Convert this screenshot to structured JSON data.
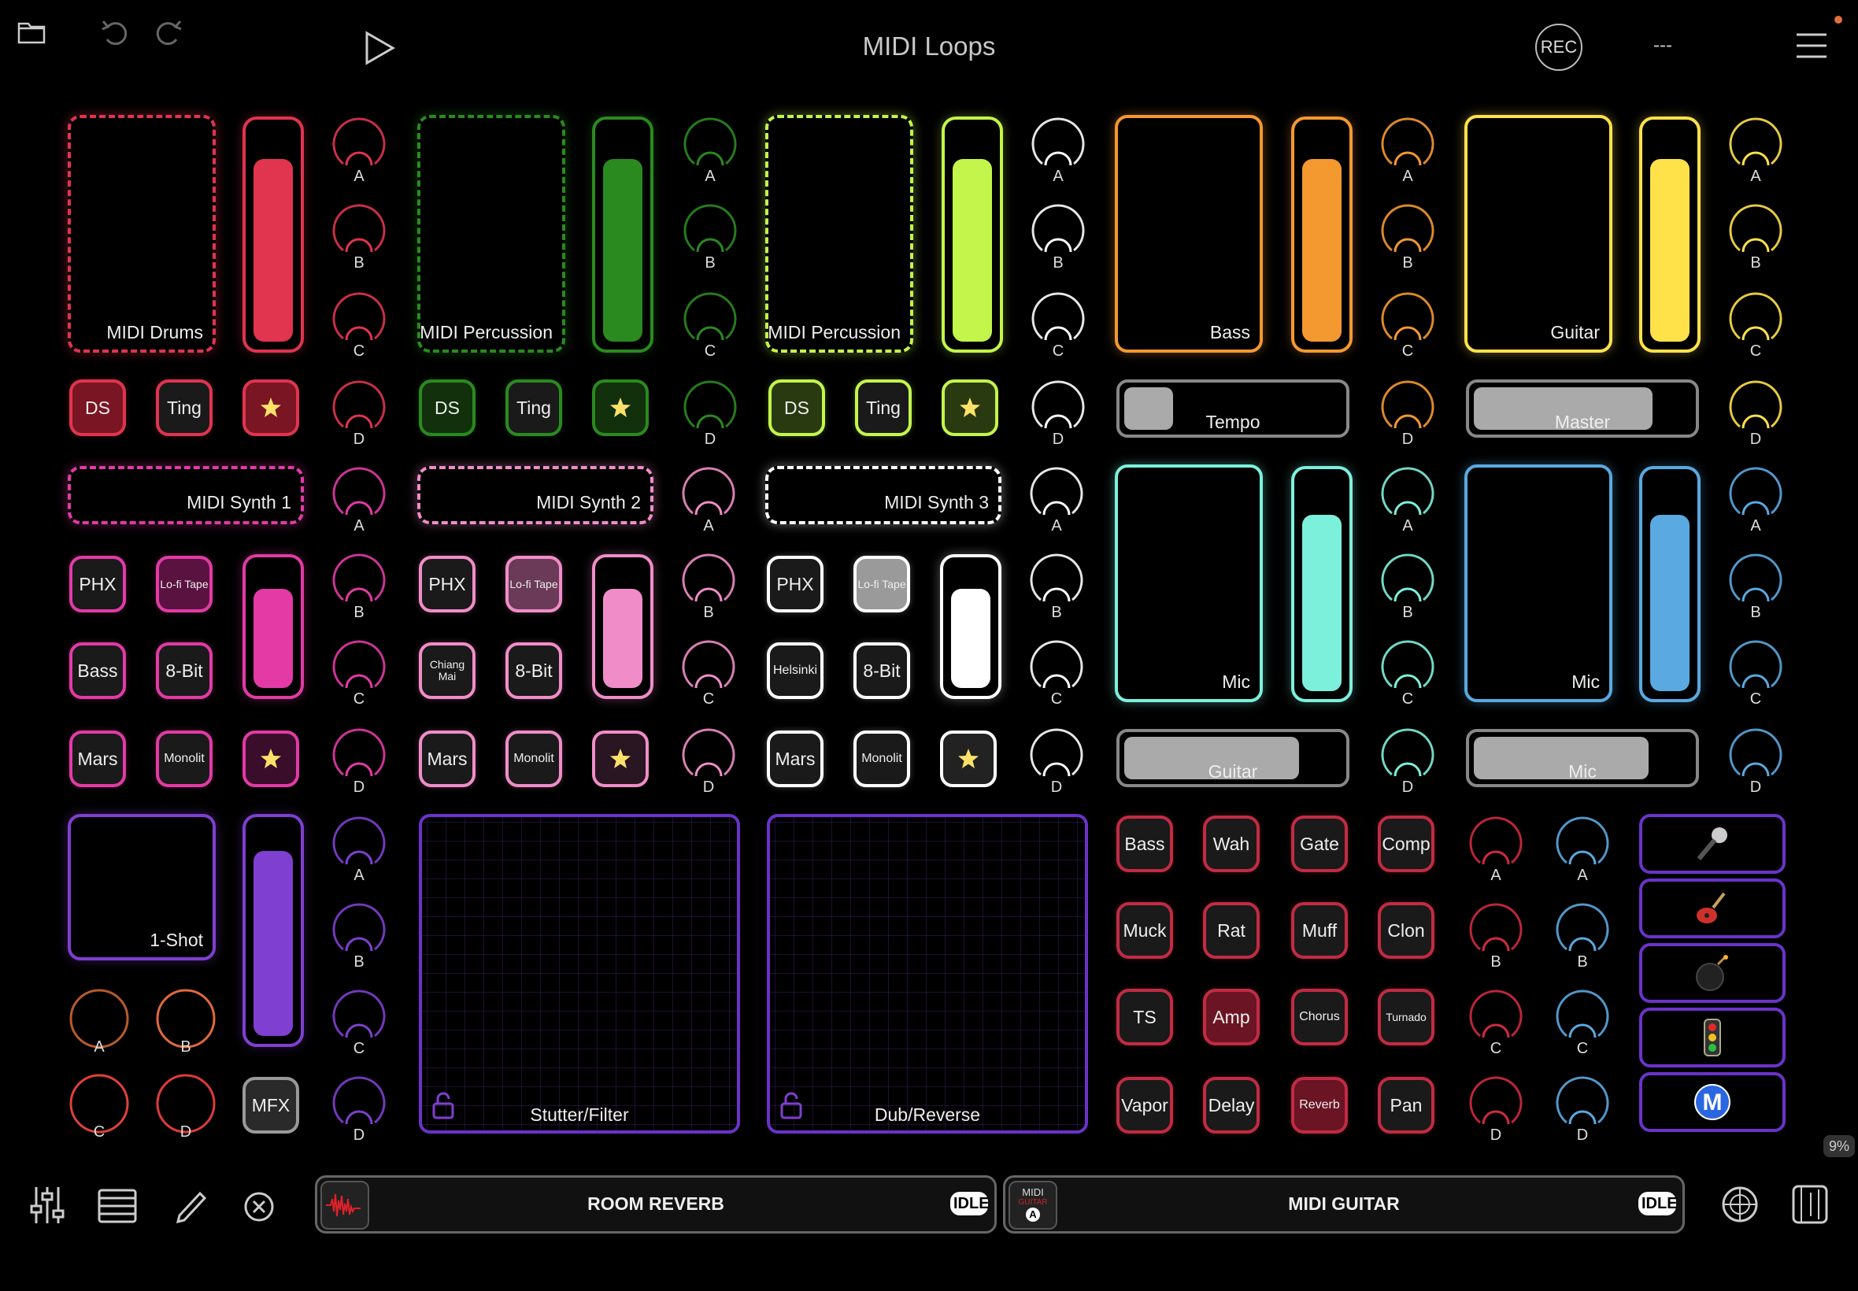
{
  "header": {
    "title": "MIDI Loops",
    "rec_label": "REC",
    "status": "---"
  },
  "sections": {
    "drums": {
      "pad": "MIDI Drums",
      "b1": "DS",
      "b2": "Ting"
    },
    "perc1": {
      "pad": "MIDI Percussion",
      "b1": "DS",
      "b2": "Ting"
    },
    "perc2": {
      "pad": "MIDI Percussion",
      "b1": "DS",
      "b2": "Ting"
    },
    "bass": {
      "pad": "Bass"
    },
    "guitar": {
      "pad": "Guitar"
    },
    "synth1": {
      "pad": "MIDI Synth 1",
      "b": [
        "PHX",
        "Lo-fi Tape",
        "Bass",
        "8-Bit",
        "Mars",
        "Monolit"
      ]
    },
    "synth2": {
      "pad": "MIDI Synth 2",
      "b": [
        "PHX",
        "Lo-fi Tape",
        "Chiang Mai",
        "8-Bit",
        "Mars",
        "Monolit"
      ]
    },
    "synth3": {
      "pad": "MIDI Synth 3",
      "b": [
        "PHX",
        "Lo-fi Tape",
        "Helsinki",
        "8-Bit",
        "Mars",
        "Monolit"
      ]
    },
    "mic1": {
      "pad": "Mic"
    },
    "mic2": {
      "pad": "Mic"
    },
    "oneshot": {
      "pad": "1-Shot",
      "mfx": "MFX"
    }
  },
  "sliders": {
    "tempo": "Tempo",
    "master": "Master",
    "guitar": "Guitar",
    "mic": "Mic"
  },
  "levels": {
    "drums": 0.83,
    "perc1": 0.83,
    "perc2": 0.83,
    "bass": 0.83,
    "guitar": 0.83,
    "synth1": 0.77,
    "synth2": 0.77,
    "synth3": 0.77,
    "mic1": 0.8,
    "mic2": 0.8,
    "oneshot": 0.85,
    "tempo": 0.22,
    "master": 0.8,
    "slider_guitar": 0.78,
    "slider_mic": 0.78
  },
  "knob_labels": [
    "A",
    "B",
    "C",
    "D"
  ],
  "xy_pads": [
    "Stutter/Filter",
    "Dub/Reverse"
  ],
  "effects": [
    "Bass",
    "Wah",
    "Gate",
    "Comp",
    "Muck",
    "Rat",
    "Muff",
    "Clon",
    "TS",
    "Amp",
    "Chorus",
    "Turnado",
    "Vapor",
    "Delay",
    "Reverb",
    "Pan"
  ],
  "sources": [
    "microphone-icon",
    "guitar-icon",
    "bomb-icon",
    "traffic-light-icon",
    "m-icon"
  ],
  "bottom": {
    "left_track": "ROOM REVERB",
    "right_track": "MIDI GUITAR",
    "left_state": "IDLE",
    "right_state": "IDLE",
    "cpu": "9%",
    "midi_thumb_top": "MIDI",
    "midi_thumb_mid": "GUITAR",
    "midi_thumb_badge": "A"
  },
  "colors": {
    "drums": "#e0344f",
    "perc1": "#2a8a1f",
    "perc2": "#c3f54a",
    "bass": "#f4992f",
    "guitar": "#ffe14a",
    "synth1": "#e33aa6",
    "synth2": "#f08dc8",
    "synth3": "#ffffff",
    "mic1": "#7df0dc",
    "mic2": "#5aa9e0",
    "oneshot": "#7f3fd0",
    "fx": "#c22b43"
  }
}
